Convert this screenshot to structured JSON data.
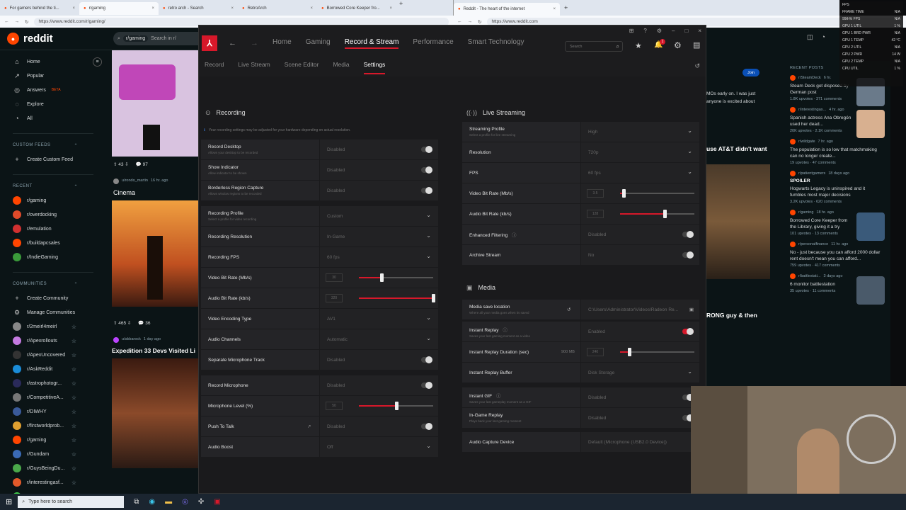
{
  "left_browser": {
    "tabs": [
      {
        "label": "For gamers behind the ti..."
      },
      {
        "label": "r/gaming",
        "active": true
      },
      {
        "label": "retro arch - Search"
      },
      {
        "label": "RetroArch"
      },
      {
        "label": "Borrowed Core Keeper fro..."
      }
    ],
    "url": "https://www.reddit.com/r/gaming/"
  },
  "right_browser": {
    "tabs": [
      {
        "label": "Reddit - The heart of the internet",
        "active": true
      }
    ],
    "url": "https://www.reddit.com"
  },
  "reddit": {
    "logo_text": "reddit",
    "search_chip": "r/gaming",
    "search_placeholder": "Search in r/",
    "nav": [
      "Home",
      "Popular",
      "Answers",
      "Explore",
      "All"
    ],
    "answers_badge": "BETA",
    "custom_feeds_header": "CUSTOM FEEDS",
    "create_custom_feed": "Create Custom Feed",
    "recent_header": "RECENT",
    "recent": [
      "r/gaming",
      "r/overdocking",
      "r/emulation",
      "r/buildapcsales",
      "r/IndieGaming"
    ],
    "communities_header": "COMMUNITIES",
    "create_community": "Create Community",
    "manage_communities": "Manage Communities",
    "communities": [
      "r/2meirl4meirl",
      "r/Apexrollouts",
      "r/ApexUncovered",
      "r/AskReddit",
      "r/astrophotogr...",
      "r/CompetitiveA...",
      "r/DIWHY",
      "r/firstworldprob...",
      "r/gaming",
      "r/Gundam",
      "r/GuysBeingDu...",
      "r/interestingasf...",
      "r/Kick"
    ],
    "feed": {
      "post1_votes": "43",
      "post1_comments": "97",
      "post2_user": "u/rondo_martin",
      "post2_time": "16 hr. ago",
      "post2_title": "Cinema",
      "post2_votes": "465",
      "post2_comments": "36",
      "post3_user": "u/akbarock",
      "post3_time": "1 day ago",
      "post3_title": "Expedition 33 Devs Visited Li"
    },
    "right": {
      "header": "RECENT POSTS",
      "join": "Join",
      "snippet1": "MOs early on. I was just",
      "snippet2": "anyone is excited about",
      "snippet3": "use AT&T didn't want",
      "snippet4": "RONG guy & then",
      "posts": [
        {
          "sub": "r/SteamDeck",
          "time": "6 hr.",
          "title": "Steam Deck got disposed by German post",
          "meta": "1.8K upvotes · 371 comments"
        },
        {
          "sub": "r/interestingas...",
          "time": "4 hr. ago",
          "title": "Spanish actress Ana Obregón used her dead...",
          "meta": "20K upvotes · 2.1K comments"
        },
        {
          "sub": "r/wildgate",
          "time": "7 hr. ago",
          "title": "The population is so low that matchmaking can no longer create...",
          "meta": "19 upvotes · 47 comments"
        },
        {
          "sub": "r/patientgamers",
          "time": "18 days ago",
          "spoiler": "SPOILER",
          "title": "Hogwarts Legacy is uninspired and it fumbles most major decisions",
          "meta": "3.2K upvotes · 620 comments"
        },
        {
          "sub": "r/gaming",
          "time": "18 hr. ago",
          "title": "Borrowed Core Keeper from the Library, giving it a try",
          "meta": "101 upvotes · 13 comments"
        },
        {
          "sub": "r/personalfinance",
          "time": "11 hr. ago",
          "title": "No - just because you can afford 2000 dollar rent doesn't mean you can afford...",
          "meta": "759 upvotes · 417 comments"
        },
        {
          "sub": "r/battlestati...",
          "time": "3 days ago",
          "title": "6 monitor battlestation",
          "meta": "35 upvotes · 11 comments"
        }
      ]
    }
  },
  "amd": {
    "nav": [
      "Home",
      "Gaming",
      "Record & Stream",
      "Performance",
      "Smart Technology"
    ],
    "active_nav": "Record & Stream",
    "search_placeholder": "Search",
    "notif_count": "1",
    "subnav": [
      "Record",
      "Live Stream",
      "Scene Editor",
      "Media",
      "Settings"
    ],
    "active_subnav": "Settings",
    "recording": {
      "title": "Recording",
      "info": "Your recording settings may be adjusted for your hardware depending on actual resolution.",
      "rows": [
        {
          "label": "Record Desktop",
          "desc": "Allows your desktop to be recorded",
          "value": "Disabled",
          "control": "toggle"
        },
        {
          "label": "Show Indicator",
          "desc": "Allow indicator to be shown",
          "value": "Disabled",
          "control": "toggle"
        },
        {
          "label": "Borderless Region Capture",
          "desc": "Allows window regions to be recorded",
          "value": "Disabled",
          "control": "toggle"
        },
        {
          "label": "Recording Profile",
          "desc": "Select a profile for video recording",
          "value": "Custom",
          "control": "dropdown"
        },
        {
          "label": "Recording Resolution",
          "desc": "",
          "value": "In-Game",
          "control": "dropdown"
        },
        {
          "label": "Recording FPS",
          "desc": "",
          "value": "60 fps",
          "control": "dropdown"
        },
        {
          "label": "Video Bit Rate (Mb/s)",
          "desc": "",
          "value": "30",
          "control": "slider",
          "level": 0.3
        },
        {
          "label": "Audio Bit Rate (kb/s)",
          "desc": "",
          "value": "320",
          "control": "slider",
          "level": 1.0
        },
        {
          "label": "Video Encoding Type",
          "desc": "",
          "value": "AV1",
          "control": "dropdown"
        },
        {
          "label": "Audio Channels",
          "desc": "",
          "value": "Automatic",
          "control": "dropdown"
        },
        {
          "label": "Separate Microphone Track",
          "desc": "",
          "value": "Disabled",
          "control": "toggle"
        },
        {
          "label": "Record Microphone",
          "desc": "",
          "value": "Disabled",
          "control": "toggle"
        },
        {
          "label": "Microphone Level (%)",
          "desc": "",
          "value": "50",
          "control": "slider",
          "level": 0.5
        },
        {
          "label": "Push To Talk",
          "desc": "",
          "value": "Disabled",
          "control": "toggle"
        },
        {
          "label": "Audio Boost",
          "desc": "",
          "value": "Off",
          "control": "dropdown"
        }
      ]
    },
    "streaming": {
      "title": "Live Streaming",
      "rows": [
        {
          "label": "Streaming Profile",
          "desc": "Select a profile for live streaming",
          "value": "High",
          "control": "dropdown"
        },
        {
          "label": "Resolution",
          "desc": "",
          "value": "720p",
          "control": "dropdown"
        },
        {
          "label": "FPS",
          "desc": "",
          "value": "60 fps",
          "control": "dropdown"
        },
        {
          "label": "Video Bit Rate (Mb/s)",
          "desc": "",
          "value": "3.5",
          "control": "slider",
          "level": 0.05
        },
        {
          "label": "Audio Bit Rate (kb/s)",
          "desc": "",
          "value": "128",
          "control": "slider",
          "level": 0.6
        },
        {
          "label": "Enhanced Filtering",
          "desc": "",
          "value": "Disabled",
          "control": "toggle"
        },
        {
          "label": "Archive Stream",
          "desc": "",
          "value": "No",
          "control": "toggle"
        }
      ]
    },
    "media": {
      "title": "Media",
      "rows": [
        {
          "label": "Media save location",
          "desc": "Where all your media goes when its saved",
          "value": "C:\\Users\\Administrator\\Videos\\Radeon Re...",
          "control": "path"
        },
        {
          "label": "Instant Replay",
          "desc": "Saves your last gaming moment as a video",
          "value": "Enabled",
          "control": "toggle-on"
        },
        {
          "label": "Instant Replay Duration (sec)",
          "desc": "",
          "extra": "900 MB",
          "value": "240",
          "control": "slider",
          "level": 0.12
        },
        {
          "label": "Instant Replay Buffer",
          "desc": "",
          "value": "Disk Storage",
          "control": "dropdown"
        },
        {
          "label": "Instant GIF",
          "desc": "Saves your last gameplay moment as a GIF",
          "value": "Disabled",
          "control": "toggle"
        },
        {
          "label": "In-Game Replay",
          "desc": "Plays back your last gaming moment",
          "value": "Disabled",
          "control": "toggle"
        },
        {
          "label": "Audio Capture Device",
          "desc": "",
          "value": "Default (Microphone (USB2.0 Device))",
          "control": "none"
        }
      ]
    }
  },
  "perf_overlay": {
    "rows": [
      {
        "k": "FPS",
        "v": ""
      },
      {
        "k": "FRAME TIME",
        "v": "N/A"
      },
      {
        "k": "99th% FPS",
        "v": "N/A"
      },
      {
        "k": "GPU 1 UTIL",
        "v": "1 %"
      },
      {
        "k": "GPU 1 BRD PWR",
        "v": "N/A"
      },
      {
        "k": "GPU 1 TEMP",
        "v": "42 °C"
      },
      {
        "k": "GPU 2 UTIL",
        "v": "N/A"
      },
      {
        "k": "GPU 2 PWR",
        "v": "14 W"
      },
      {
        "k": "GPU 2 TEMP",
        "v": "N/A"
      },
      {
        "k": "CPU UTIL",
        "v": "1 %"
      }
    ]
  },
  "taskbar": {
    "search_placeholder": "Type here to search"
  },
  "colors": {
    "amd_red": "#d7182a",
    "reddit_orange": "#ff4500",
    "reddit_bg": "#0b1416"
  }
}
